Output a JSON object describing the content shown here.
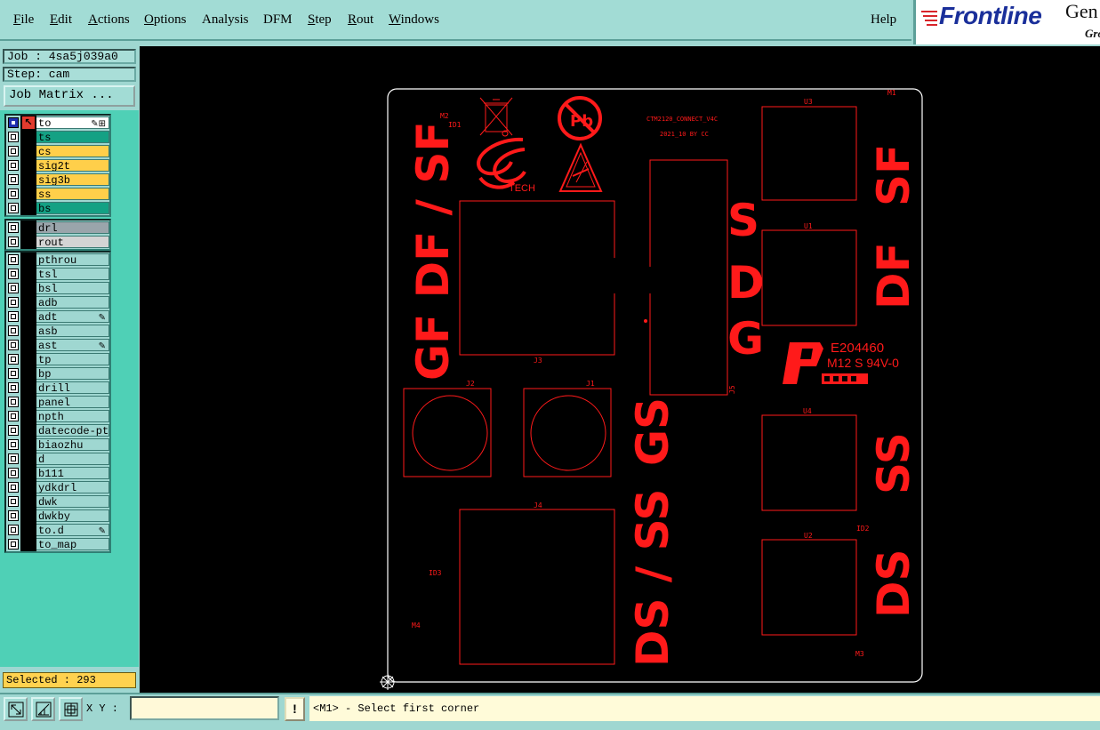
{
  "menubar": {
    "items": [
      {
        "label": "File",
        "underline": "F",
        "rest": "ile"
      },
      {
        "label": "Edit",
        "underline": "E",
        "rest": "dit"
      },
      {
        "label": "Actions",
        "underline": "A",
        "rest": "ctions"
      },
      {
        "label": "Options",
        "underline": "O",
        "rest": "ptions"
      },
      {
        "label": "Analysis",
        "underline": "",
        "rest": "Analysis"
      },
      {
        "label": "DFM",
        "underline": "",
        "rest": "DFM"
      },
      {
        "label": "Step",
        "underline": "S",
        "rest": "tep"
      },
      {
        "label": "Rout",
        "underline": "R",
        "rest": "out"
      },
      {
        "label": "Windows",
        "underline": "W",
        "rest": "indows"
      }
    ],
    "help": "Help"
  },
  "logo": {
    "brand": "Frontline",
    "gen": "Gen",
    "gro": "Gro"
  },
  "left_panel": {
    "job": "Job : 4sa5j039a0",
    "step": "Step: cam",
    "job_matrix_button": "Job Matrix ...",
    "selected": "Selected : 293",
    "layer_groups": [
      [
        {
          "name": "to",
          "color": "#ffffff",
          "selected": true,
          "arrow": true,
          "mark": "✎⊞"
        },
        {
          "name": "ts",
          "color": "#14a184"
        },
        {
          "name": "cs",
          "color": "#ffcf4a"
        },
        {
          "name": "sig2t",
          "color": "#ffcf4a"
        },
        {
          "name": "sig3b",
          "color": "#ffcf4a"
        },
        {
          "name": "ss",
          "color": "#ffcf4a"
        },
        {
          "name": "bs",
          "color": "#14a184"
        }
      ],
      [
        {
          "name": "drl",
          "color": "#9aa5ab"
        },
        {
          "name": "rout",
          "color": "#d4d4d4"
        }
      ],
      [
        {
          "name": "pthrou",
          "color": "#9fd7d1"
        },
        {
          "name": "tsl",
          "color": "#9fd7d1"
        },
        {
          "name": "bsl",
          "color": "#9fd7d1"
        },
        {
          "name": "adb",
          "color": "#9fd7d1"
        },
        {
          "name": "adt",
          "color": "#9fd7d1",
          "mark": "✎"
        },
        {
          "name": "asb",
          "color": "#9fd7d1"
        },
        {
          "name": "ast",
          "color": "#9fd7d1",
          "mark": "✎"
        },
        {
          "name": "tp",
          "color": "#9fd7d1"
        },
        {
          "name": "bp",
          "color": "#9fd7d1"
        },
        {
          "name": "drill",
          "color": "#9fd7d1"
        },
        {
          "name": "panel",
          "color": "#9fd7d1"
        },
        {
          "name": "npth",
          "color": "#9fd7d1"
        },
        {
          "name": "datecode-ptc",
          "color": "#9fd7d1"
        },
        {
          "name": "biaozhu",
          "color": "#9fd7d1"
        },
        {
          "name": "d",
          "color": "#9fd7d1"
        },
        {
          "name": "b111",
          "color": "#9fd7d1"
        },
        {
          "name": "ydkdrl",
          "color": "#9fd7d1"
        },
        {
          "name": "dwk",
          "color": "#9fd7d1"
        },
        {
          "name": "dwkby",
          "color": "#9fd7d1"
        },
        {
          "name": "to.d",
          "color": "#9fd7d1",
          "mark": "✎"
        },
        {
          "name": "to_map",
          "color": "#9fd7d1"
        }
      ]
    ]
  },
  "board": {
    "title_line1": "CTM2120_CONNECT_V4C",
    "title_line2": "2021_10 BY CC",
    "ul_line1": "E204460",
    "ul_line2": "M12 S 94V-0",
    "tech": "TECH",
    "pb": "Pb",
    "big_labels": {
      "gf_df_sf": "GF DF / SF",
      "gs": "GS",
      "ds_ss": "DS / SS",
      "s": "S",
      "d": "D",
      "g": "G",
      "sf": "SF",
      "df": "DF",
      "ss": "SS",
      "ds": "DS"
    },
    "refdes": {
      "m1": "M1",
      "m2": "M2",
      "m3": "M3",
      "m4": "M4",
      "id1": "ID1",
      "id2": "ID2",
      "id3": "ID3",
      "u1": "U1",
      "u2": "U2",
      "u3": "U3",
      "u4": "U4",
      "j1": "J1",
      "j2": "J2",
      "j3": "J3",
      "j4": "J4",
      "j5": "J5"
    },
    "colors": {
      "outline": "#ffffff",
      "copper": "#ff1a1a",
      "background": "#000000"
    }
  },
  "bottom": {
    "xy_label": "X Y :",
    "xy_value": "",
    "excl": "!",
    "status": "<M1> - Select first corner"
  }
}
